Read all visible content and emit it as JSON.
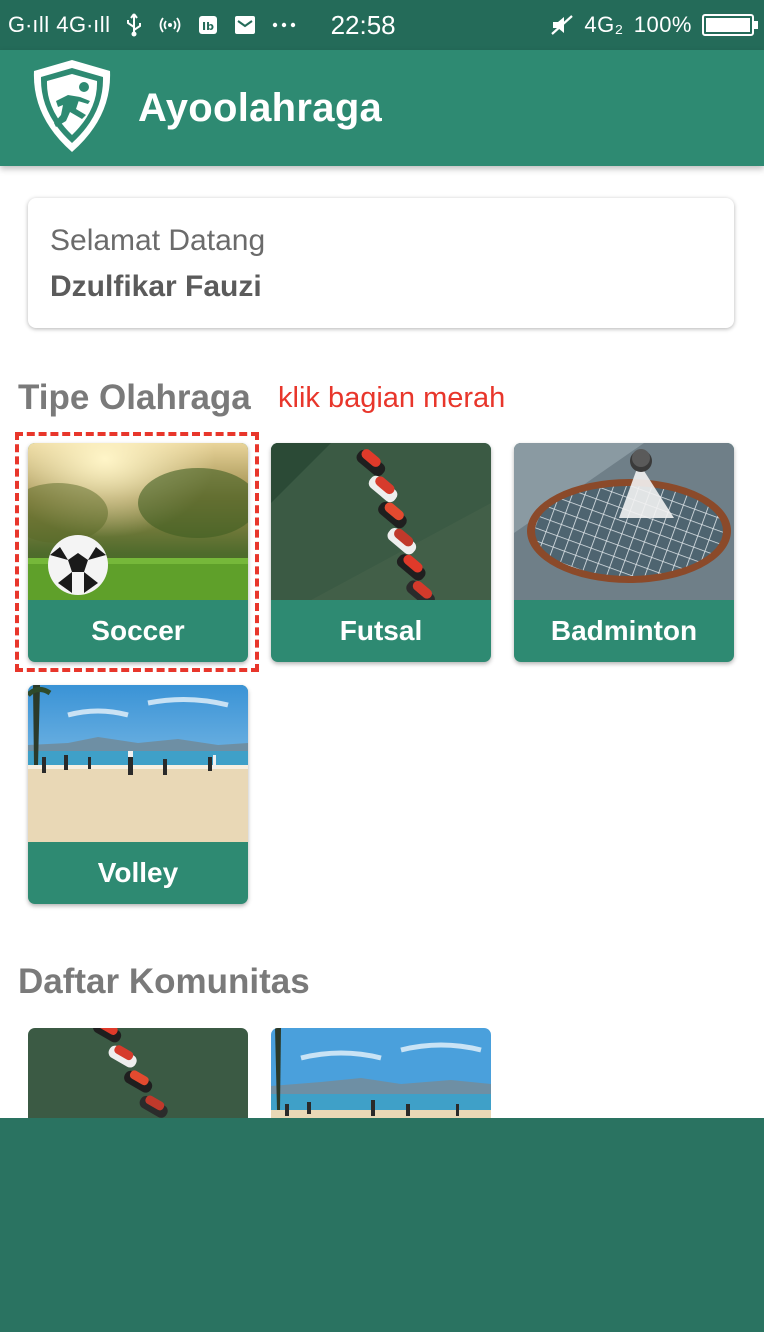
{
  "status_bar": {
    "signal_left": "G∙ıll 4G∙ıll",
    "time": "22:58",
    "network": "4G₂",
    "battery": "100%",
    "battery_level": 1.0,
    "icons": [
      "usb-icon",
      "hotspot-icon",
      "sim-icon",
      "mail-icon",
      "more-dots-icon",
      "mute-icon"
    ]
  },
  "app_bar": {
    "title": "Ayoolahraga",
    "logo_icon": "runner-shield-icon"
  },
  "welcome": {
    "greeting": "Selamat Datang",
    "user_name": "Dzulfikar Fauzi"
  },
  "sports_section": {
    "title": "Tipe Olahraga",
    "hint": "klik bagian merah",
    "items": [
      {
        "label": "Soccer"
      },
      {
        "label": "Futsal"
      },
      {
        "label": "Badminton"
      },
      {
        "label": "Volley"
      }
    ]
  },
  "community_section": {
    "title": "Daftar Komunitas"
  },
  "colors": {
    "primary": "#2e8a72",
    "status_bar": "#246b59",
    "bottom_panel": "#2a7361",
    "hint_red": "#e8362b"
  }
}
